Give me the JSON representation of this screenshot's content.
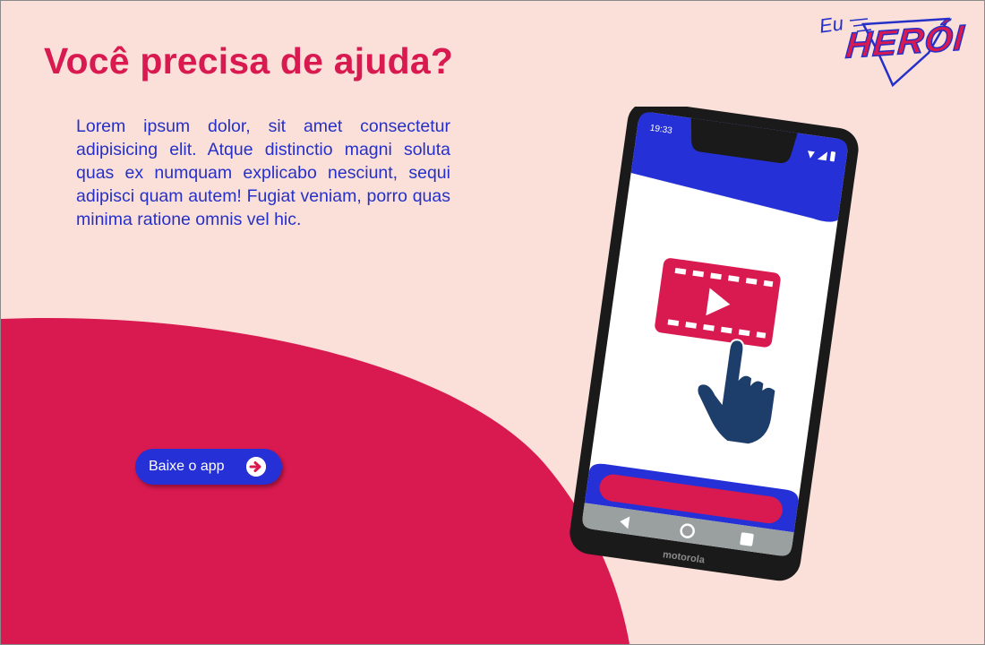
{
  "hero": {
    "title": "Você precisa de ajuda?",
    "description": "Lorem ipsum dolor, sit amet consectetur adipisicing elit. Atque distinctio magni soluta quas ex numquam explicabo nesciunt, sequi adipisci quam autem! Fugiat veniam, porro quas minima ratione omnis vel hic."
  },
  "cta": {
    "label": "Baixe o app",
    "icon": "arrow-right-circle-icon"
  },
  "logo": {
    "small": "Eu",
    "big": "HERÓI"
  },
  "phone": {
    "time": "19:33",
    "brand": "motorola",
    "screen_icon": "video-play-icon",
    "pointer_icon": "hand-pointer-icon",
    "nav_icons": [
      "back-icon",
      "home-icon",
      "recents-icon"
    ]
  },
  "colors": {
    "background": "#fbe0da",
    "accent": "#d81a50",
    "primary": "#2530c8",
    "hand": "#1d3d6b"
  }
}
